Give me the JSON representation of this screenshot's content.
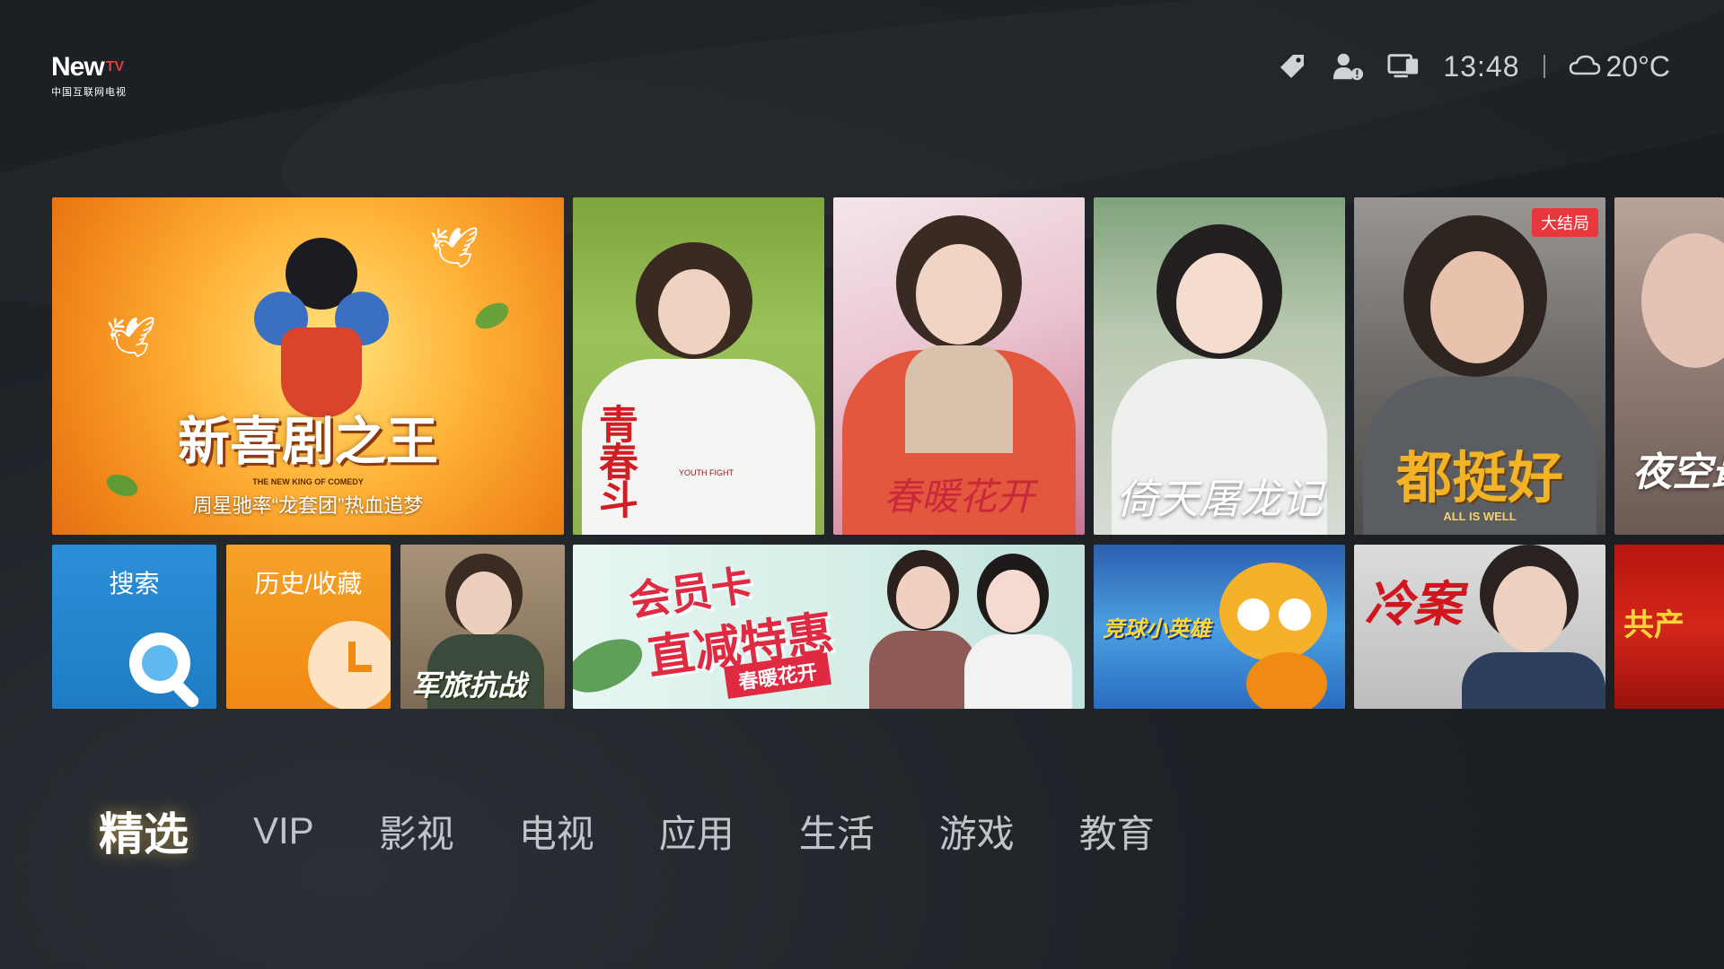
{
  "logo": {
    "brand": "New",
    "brand_tv": "TV",
    "subtitle": "中国互联网电视"
  },
  "status": {
    "icons": [
      "tag-icon",
      "user-alert-icon",
      "monitor-icon",
      "cloud-icon"
    ],
    "time": "13:48",
    "temperature": "20°C"
  },
  "tiles": {
    "feature": {
      "title": "新喜剧之王",
      "sub_en": "THE NEW KING OF COMEDY",
      "caption": "周星驰率“龙套团”热血追梦"
    },
    "poster1": {
      "title": "青春斗",
      "sub_en": "YOUTH FIGHT"
    },
    "poster2": {
      "title": "春暖花开"
    },
    "poster3": {
      "title": "倚天屠龙记"
    },
    "poster4": {
      "title": "都挺好",
      "sub_en": "ALL IS WELL",
      "badge": "大结局"
    },
    "poster5": {
      "title": "夜空最亮"
    },
    "search": {
      "label": "搜索"
    },
    "history": {
      "label": "历史/收藏"
    },
    "military": {
      "title": "军旅抗战"
    },
    "vip_banner": {
      "line1": "会员卡",
      "line2": "直减特惠",
      "tag": "春暖花开"
    },
    "kids": {
      "title": "竞球小英雄"
    },
    "drama": {
      "title": "冷案"
    },
    "party": {
      "title": "共产"
    }
  },
  "tabs": [
    "精选",
    "VIP",
    "影视",
    "电视",
    "应用",
    "生活",
    "游戏",
    "教育"
  ],
  "active_tab": "精选"
}
